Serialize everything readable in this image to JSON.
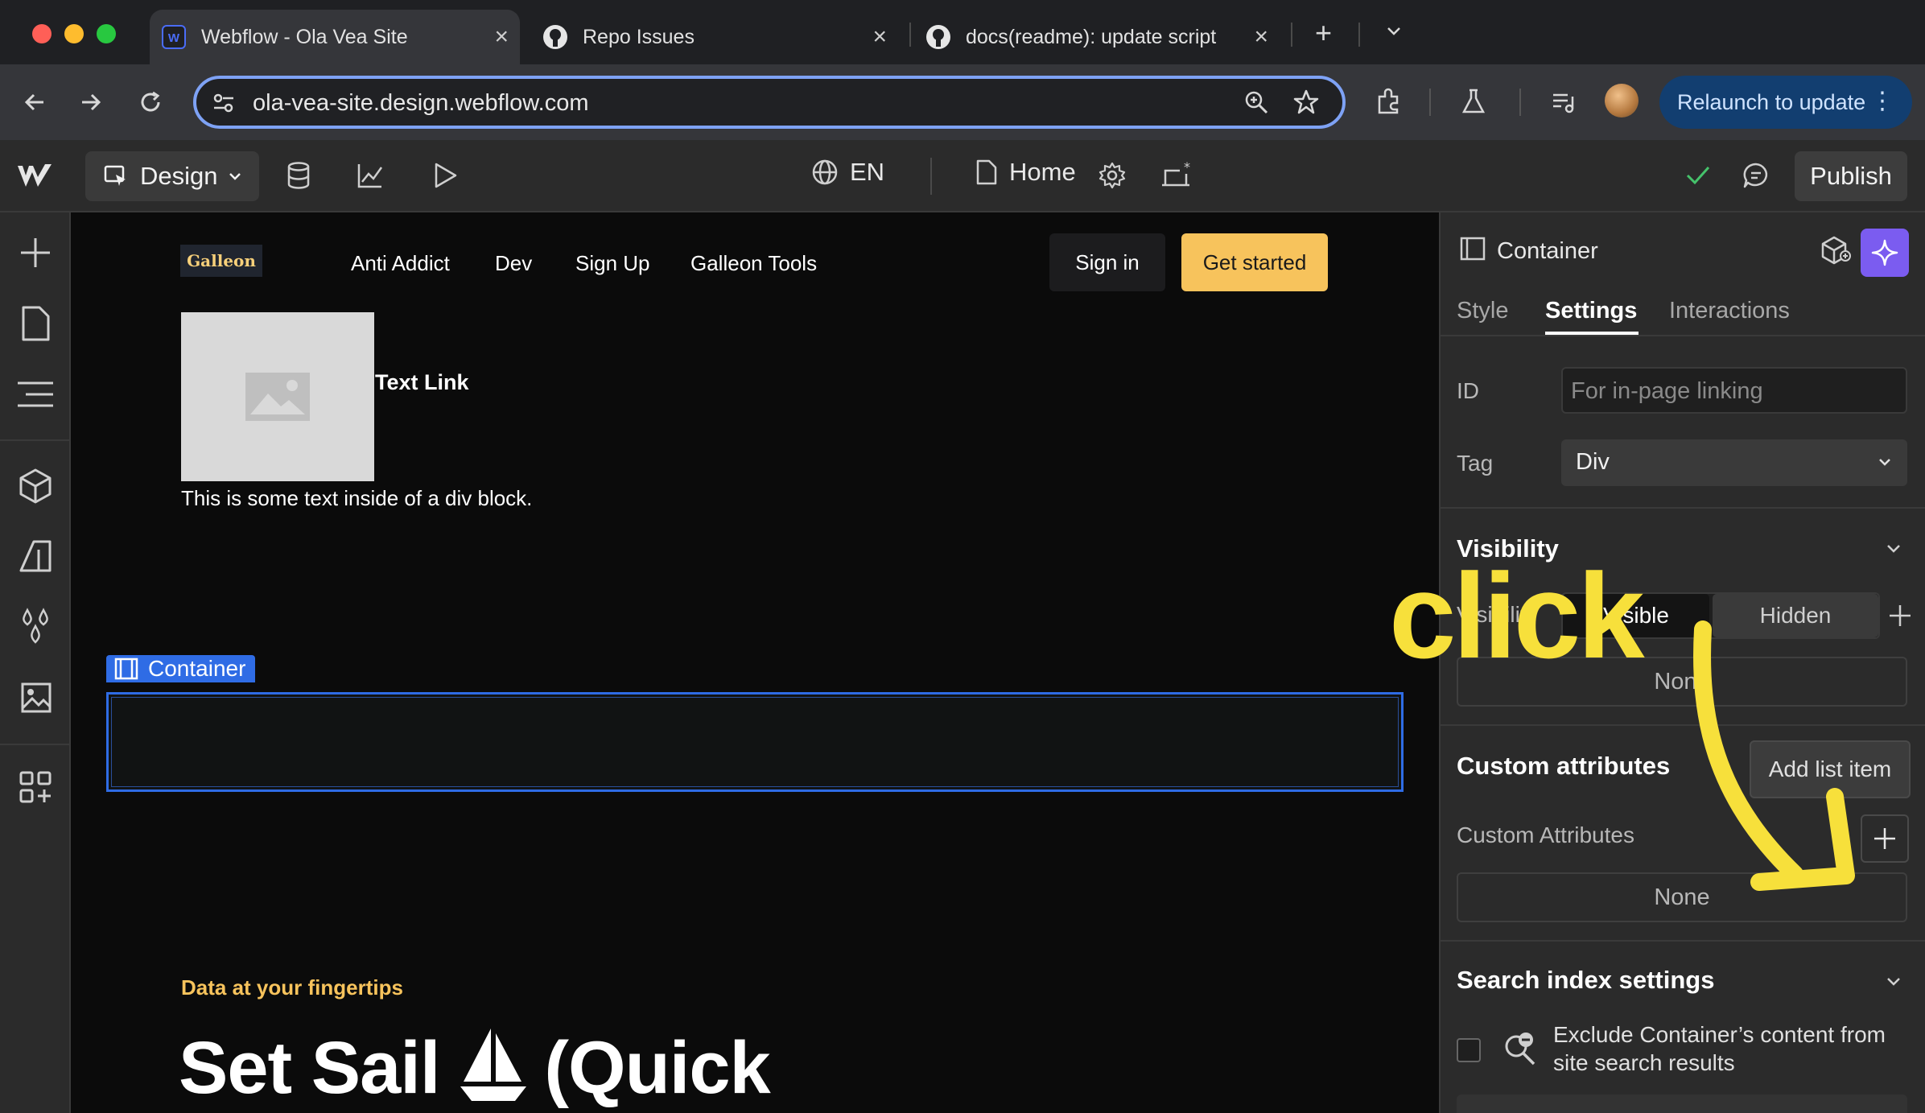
{
  "browser": {
    "tabs": [
      {
        "title": "Webflow - Ola Vea Site"
      },
      {
        "title": "Repo Issues"
      },
      {
        "title": "docs(readme): update script"
      }
    ],
    "url": "ola-vea-site.design.webflow.com",
    "relaunch_label": "Relaunch to update"
  },
  "webflow": {
    "mode_label": "Design",
    "locale": "EN",
    "page_name": "Home",
    "publish_label": "Publish"
  },
  "site": {
    "logo": "Galleon",
    "nav": [
      "Anti Addict",
      "Dev",
      "Sign Up",
      "Galleon Tools"
    ],
    "signin": "Sign in",
    "getstarted": "Get started",
    "textlink": "Text Link",
    "divtext": "This is some text inside of a div block.",
    "selected_label": "Container",
    "eyebrow": "Data at your fingertips",
    "headline_part1": "Set Sail",
    "headline_part2": "(Quick"
  },
  "panel": {
    "element_name": "Container",
    "tabs": [
      "Style",
      "Settings",
      "Interactions"
    ],
    "id_label": "ID",
    "id_placeholder": "For in-page linking",
    "tag_label": "Tag",
    "tag_value": "Div",
    "visibility_title": "Visibility",
    "visibility_row_label": "Visibility",
    "visible_option": "Visible",
    "hidden_option": "Hidden",
    "visibility_conditions": "None",
    "custom_attr_title": "Custom attributes",
    "custom_attr_label": "Custom Attributes",
    "custom_attr_value": "None",
    "tooltip": "Add list item",
    "search_title": "Search index settings",
    "search_checkbox_text": "Exclude Container’s content from site search results"
  },
  "annotation": {
    "text": "click",
    "color": "#f7e03b"
  }
}
